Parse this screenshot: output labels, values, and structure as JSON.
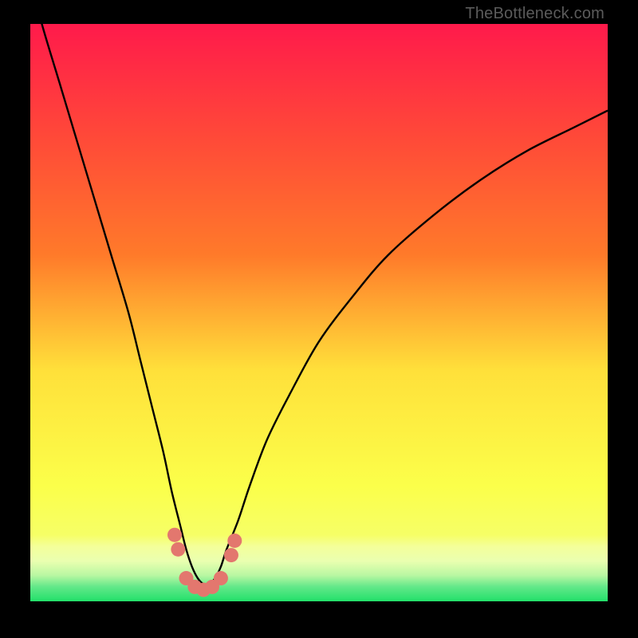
{
  "attribution": "TheBottleneck.com",
  "colors": {
    "black": "#000000",
    "grad_top": "#ff1a4b",
    "grad_mid_upper": "#ff7a2a",
    "grad_mid": "#ffe03a",
    "grad_low": "#f6ff66",
    "grad_pale": "#eaffb0",
    "grad_green": "#22e06a",
    "curve": "#000000",
    "marker": "#e3776e"
  },
  "chart_data": {
    "type": "line",
    "title": "",
    "xlabel": "",
    "ylabel": "",
    "xlim": [
      0,
      100
    ],
    "ylim": [
      0,
      100
    ],
    "legend": false,
    "grid": false,
    "series": [
      {
        "name": "bottleneck-curve",
        "x": [
          0,
          2,
          5,
          8,
          11,
          14,
          17,
          19,
          21,
          23,
          24.5,
          26,
          27,
          28,
          29,
          30,
          31,
          32,
          33,
          34,
          36,
          38,
          41,
          45,
          50,
          56,
          62,
          70,
          78,
          86,
          94,
          100
        ],
        "y": [
          108,
          100,
          90,
          80,
          70,
          60,
          50,
          42,
          34,
          26,
          19,
          13,
          9,
          6,
          4,
          3,
          3,
          4,
          6,
          9,
          14,
          20,
          28,
          36,
          45,
          53,
          60,
          67,
          73,
          78,
          82,
          85
        ]
      }
    ],
    "markers": [
      {
        "x": 25.0,
        "y": 11.5
      },
      {
        "x": 25.6,
        "y": 9.0
      },
      {
        "x": 27.0,
        "y": 4.0
      },
      {
        "x": 28.5,
        "y": 2.5
      },
      {
        "x": 30.0,
        "y": 2.0
      },
      {
        "x": 31.5,
        "y": 2.5
      },
      {
        "x": 33.0,
        "y": 4.0
      },
      {
        "x": 34.8,
        "y": 8.0
      },
      {
        "x": 35.4,
        "y": 10.5
      }
    ],
    "annotations": []
  }
}
